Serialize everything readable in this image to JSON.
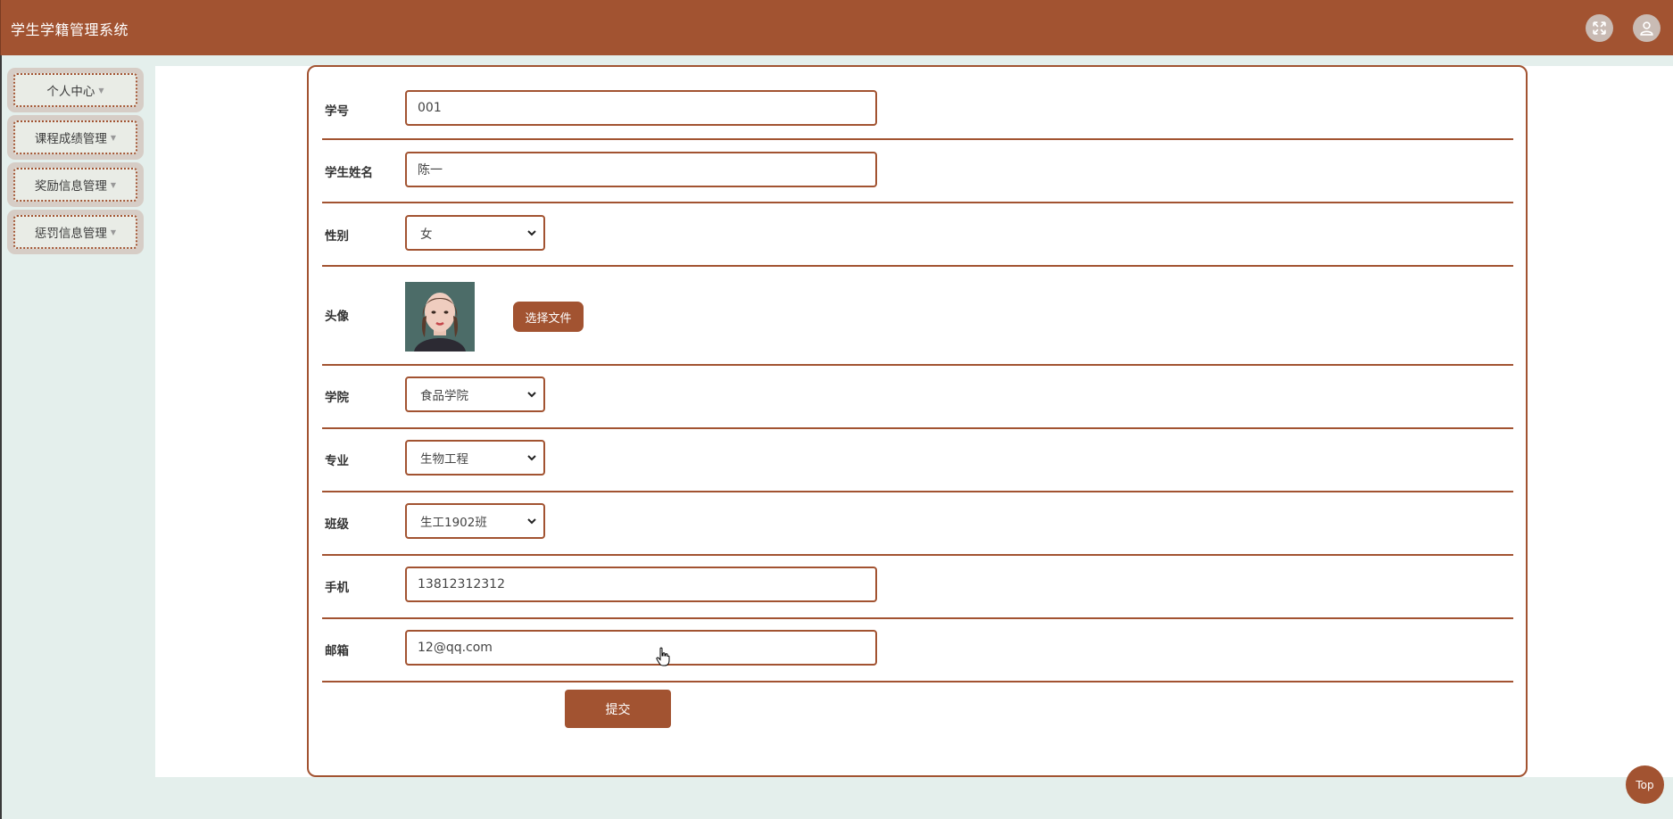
{
  "app": {
    "title": "学生学籍管理系统"
  },
  "header": {
    "icons": [
      "fullscreen-icon",
      "user-icon"
    ]
  },
  "sidebar": {
    "items": [
      {
        "label": "个人中心"
      },
      {
        "label": "课程成绩管理"
      },
      {
        "label": "奖励信息管理"
      },
      {
        "label": "惩罚信息管理"
      }
    ]
  },
  "form": {
    "student_id": {
      "label": "学号",
      "value": "001"
    },
    "student_name": {
      "label": "学生姓名",
      "value": "陈一"
    },
    "gender": {
      "label": "性别",
      "value": "女"
    },
    "avatar": {
      "label": "头像",
      "button": "选择文件"
    },
    "college": {
      "label": "学院",
      "value": "食品学院"
    },
    "major": {
      "label": "专业",
      "value": "生物工程"
    },
    "class": {
      "label": "班级",
      "value": "生工1902班"
    },
    "phone": {
      "label": "手机",
      "value": "13812312312"
    },
    "email": {
      "label": "邮箱",
      "value": "12@qq.com"
    },
    "submit": "提交"
  },
  "back_to_top": "Top",
  "colors": {
    "primary": "#a25331",
    "background": "#e4efec",
    "menu_bg": "#d6cdc6"
  }
}
